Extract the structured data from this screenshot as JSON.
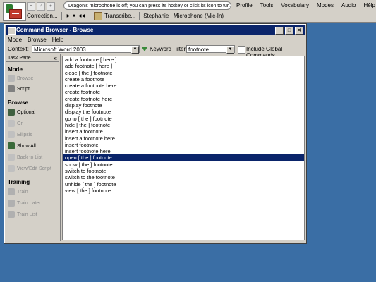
{
  "dragonbar": {
    "message": "Dragon's microphone is off; you can press its hotkey or click its icon to tur...",
    "menu": [
      "Profile",
      "Tools",
      "Vocabulary",
      "Modes",
      "Audio",
      "Help"
    ],
    "correction_label": "Correction...",
    "transcribe_label": "Transcribe...",
    "user_status": "Stephanie : Microphone (Mic-In)"
  },
  "window": {
    "title": "Command Browser - Browse",
    "menu": [
      "Mode",
      "Browse",
      "Help"
    ],
    "context_label": "Context:",
    "context_value": "Microsoft Word 2003",
    "keyword_filter_label": "Keyword Filter",
    "keyword_value": "footnote",
    "include_global_label": "Include Global Commands"
  },
  "taskpane": {
    "header": "Task Pane",
    "collapse_glyph": "«",
    "sections": {
      "mode": {
        "title": "Mode",
        "items": [
          "Browse",
          "Script"
        ]
      },
      "browse": {
        "title": "Browse",
        "items": [
          "Optional",
          "Or",
          "Ellipsis",
          "Show All",
          "Back to List",
          "View/Edit Script"
        ]
      },
      "training": {
        "title": "Training",
        "items": [
          "Train",
          "Train Later",
          "Train List"
        ]
      }
    }
  },
  "commands": [
    "add a footnote [ here ]",
    "add footnote [ here ]",
    "close [ the ] footnote",
    "create a footnote",
    "create a footnote here",
    "create footnote",
    "create footnote here",
    "display footnote",
    "display the footnote",
    "go to [ the ] footnote",
    "hide [ the ] footnote",
    "insert a footnote",
    "insert a footnote here",
    "insert footnote",
    "insert footnote here",
    "open [ the ] footnote",
    "show [ the ] footnote",
    "switch to footnote",
    "switch to the footnote",
    "unhide [ the ] footnote",
    "view [ the ] footnote"
  ],
  "selected_index": 15,
  "colors": {
    "selection": "#0a246a",
    "titlebar": "#0a246a",
    "desktop": "#3a6ea5"
  }
}
